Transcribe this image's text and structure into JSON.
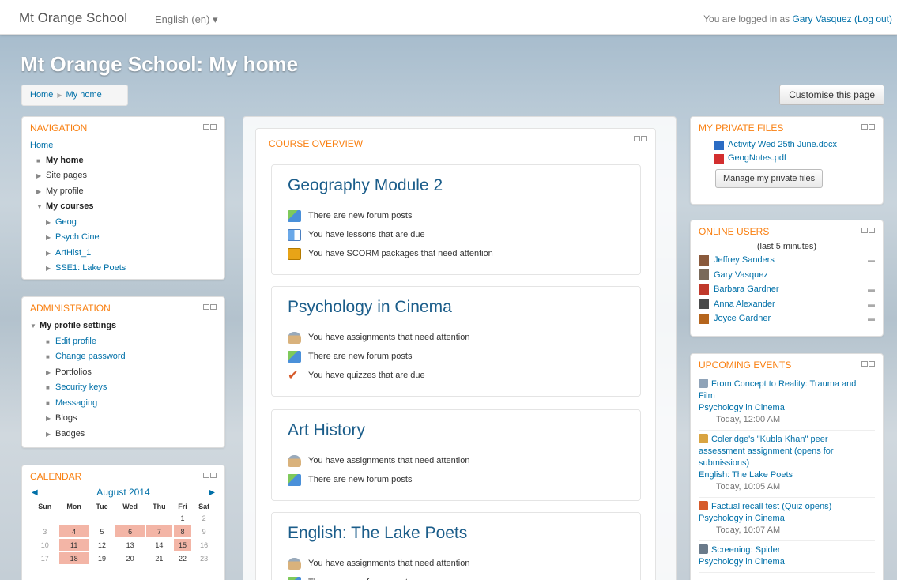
{
  "topbar": {
    "brand": "Mt Orange School",
    "language": "English (en) ▾",
    "login_prefix": "You are logged in as ",
    "user": "Gary Vasquez",
    "logout": "(Log out)"
  },
  "page_title": "Mt Orange School: My home",
  "breadcrumb": {
    "home": "Home",
    "separator": "▶",
    "current": "My home"
  },
  "customise_button": "Customise this page",
  "navigation": {
    "title": "NAVIGATION",
    "home": "Home",
    "my_home": "My home",
    "site_pages": "Site pages",
    "my_profile": "My profile",
    "my_courses": "My courses",
    "courses": [
      "Geog",
      "Psych Cine",
      "ArtHist_1",
      "SSE1: Lake Poets"
    ]
  },
  "administration": {
    "title": "ADMINISTRATION",
    "profile_settings": "My profile settings",
    "items": [
      "Edit profile",
      "Change password",
      "Portfolios",
      "Security keys",
      "Messaging",
      "Blogs",
      "Badges"
    ]
  },
  "calendar": {
    "title": "CALENDAR",
    "month": "August 2014",
    "prev": "◀",
    "next": "▶",
    "days": [
      "Sun",
      "Mon",
      "Tue",
      "Wed",
      "Thu",
      "Fri",
      "Sat"
    ],
    "weeks": [
      [
        "",
        "",
        "",
        "",
        "",
        "1",
        "2"
      ],
      [
        "3",
        "4",
        "5",
        "6",
        "7",
        "8",
        "9"
      ],
      [
        "10",
        "11",
        "12",
        "13",
        "14",
        "15",
        "16"
      ],
      [
        "17",
        "18",
        "19",
        "20",
        "21",
        "22",
        "23"
      ]
    ],
    "highlight_color": "#f3b5a6"
  },
  "course_overview": {
    "title": "COURSE OVERVIEW",
    "courses": [
      {
        "name": "Geography Module 2",
        "items": [
          {
            "icon": "forum-icon",
            "text": "There are new forum posts"
          },
          {
            "icon": "lesson-icon",
            "text": "You have lessons that are due"
          },
          {
            "icon": "scorm-icon",
            "text": "You have SCORM packages that need attention"
          }
        ]
      },
      {
        "name": "Psychology in Cinema",
        "items": [
          {
            "icon": "assignment-icon",
            "text": "You have assignments that need attention"
          },
          {
            "icon": "forum-icon",
            "text": "There are new forum posts"
          },
          {
            "icon": "quiz-icon",
            "text": "You have quizzes that are due"
          }
        ]
      },
      {
        "name": "Art History",
        "items": [
          {
            "icon": "assignment-icon",
            "text": "You have assignments that need attention"
          },
          {
            "icon": "forum-icon",
            "text": "There are new forum posts"
          }
        ]
      },
      {
        "name": "English: The Lake Poets",
        "items": [
          {
            "icon": "assignment-icon",
            "text": "You have assignments that need attention"
          },
          {
            "icon": "forum-icon",
            "text": "There are new forum posts"
          }
        ]
      }
    ]
  },
  "private_files": {
    "title": "MY PRIVATE FILES",
    "files": [
      "Activity Wed 25th June.docx",
      "GeogNotes.pdf"
    ],
    "manage_button": "Manage my private files"
  },
  "online_users": {
    "title": "ONLINE USERS",
    "subtitle": "(last 5 minutes)",
    "users": [
      "Jeffrey Sanders",
      "Gary Vasquez",
      "Barbara Gardner",
      "Anna Alexander",
      "Joyce Gardner"
    ]
  },
  "upcoming_events": {
    "title": "UPCOMING EVENTS",
    "events": [
      {
        "name": "From Concept to Reality: Trauma and Film",
        "course": "Psychology in Cinema",
        "time": "Today, 12:00 AM"
      },
      {
        "name": "Coleridge's \"Kubla Khan\" peer assessment assignment (opens for submissions)",
        "course": "English: The Lake Poets",
        "time": "Today, 10:05 AM"
      },
      {
        "name": "Factual recall test (Quiz opens)",
        "course": "Psychology in Cinema",
        "time": "Today, 10:07 AM"
      },
      {
        "name": "Screening: Spider",
        "course": "Psychology in Cinema",
        "time": ""
      }
    ]
  },
  "accent_color": "#f98012",
  "link_color": "#0070a8"
}
